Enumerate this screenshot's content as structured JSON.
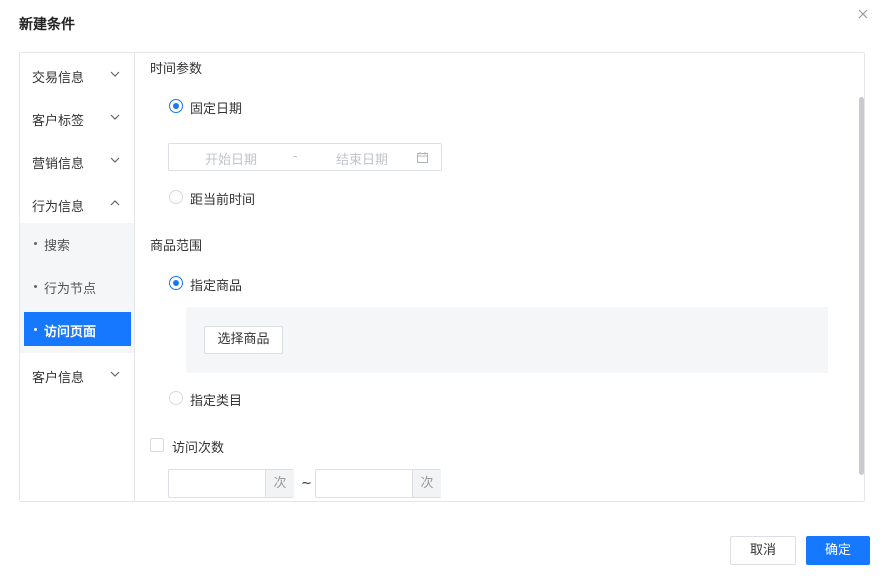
{
  "dialog": {
    "title": "新建条件"
  },
  "sidebar": {
    "groups": [
      {
        "label": "交易信息"
      },
      {
        "label": "客户标签"
      },
      {
        "label": "营销信息"
      },
      {
        "label": "行为信息"
      },
      {
        "label": "客户信息"
      }
    ],
    "behavior_items": [
      {
        "label": "搜索"
      },
      {
        "label": "行为节点"
      },
      {
        "label": "访问页面",
        "active": true
      }
    ]
  },
  "main": {
    "time_section": {
      "title": "时间参数",
      "fixed_date_label": "固定日期",
      "start_placeholder": "开始日期",
      "range_separator": "-",
      "end_placeholder": "结束日期",
      "relative_label": "距当前时间",
      "selected": "固定日期"
    },
    "goods_section": {
      "title": "商品范围",
      "specific_goods_label": "指定商品",
      "select_goods_button": "选择商品",
      "specific_category_label": "指定类目",
      "selected": "指定商品"
    },
    "visit_count": {
      "label": "访问次数",
      "checked": false,
      "unit": "次",
      "range_separator": "~"
    }
  },
  "footer": {
    "cancel_label": "取消",
    "ok_label": "确定"
  },
  "colors": {
    "primary": "#1677ff",
    "border": "#dcdfe6",
    "panel_bg": "#f5f6f8"
  }
}
